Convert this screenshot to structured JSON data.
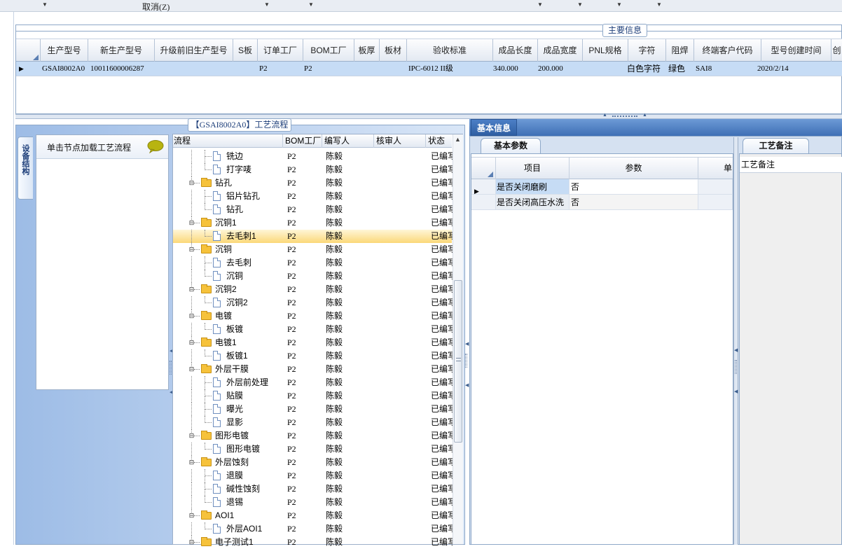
{
  "toolbar": {
    "cancel_label": "取消(Z)"
  },
  "main_info": {
    "title": "主要信息",
    "columns": [
      "生产型号",
      "新生产型号",
      "升级前旧生产型号",
      "S板",
      "订单工厂",
      "BOM工厂",
      "板厚",
      "板材",
      "验收标准",
      "成品长度",
      "成品宽度",
      "PNL规格",
      "字符",
      "阻焊",
      "终端客户代码",
      "型号创建时间",
      "创"
    ],
    "row": {
      "production_model": "GSAI8002A0",
      "new_model": "10011600006287",
      "old_model": "",
      "s_board": "",
      "order_factory": "P2",
      "bom_factory": "P2",
      "thickness": "",
      "material": "",
      "acceptance": "IPC-6012 II级",
      "length": "340.000",
      "width": "200.000",
      "pnl": "",
      "char": "白色字符",
      "solder_mask": "绿色",
      "customer_code": "SAI8",
      "created": "2020/2/14"
    }
  },
  "process": {
    "title": "【GSAI8002A0】工艺流程",
    "side_tab_label": "设备结构",
    "tree_hint": "单击节点加载工艺流程",
    "columns": [
      "流程",
      "BOM工厂",
      "编写人",
      "核审人",
      "状态"
    ],
    "rows": [
      {
        "level": 2,
        "name": "铣边",
        "factory": "P2",
        "writer": "陈毅",
        "reviewer": "",
        "status": "已编写",
        "folder": false
      },
      {
        "level": 2,
        "name": "打字唛",
        "factory": "P2",
        "writer": "陈毅",
        "reviewer": "",
        "status": "已编写",
        "folder": false
      },
      {
        "level": 1,
        "name": "钻孔",
        "factory": "P2",
        "writer": "陈毅",
        "reviewer": "",
        "status": "已编写",
        "folder": true
      },
      {
        "level": 2,
        "name": "铝片钻孔",
        "factory": "P2",
        "writer": "陈毅",
        "reviewer": "",
        "status": "已编写",
        "folder": false
      },
      {
        "level": 2,
        "name": "钻孔",
        "factory": "P2",
        "writer": "陈毅",
        "reviewer": "",
        "status": "已编写",
        "folder": false
      },
      {
        "level": 1,
        "name": "沉铜1",
        "factory": "P2",
        "writer": "陈毅",
        "reviewer": "",
        "status": "已编写",
        "folder": true
      },
      {
        "level": 2,
        "name": "去毛刺1",
        "factory": "P2",
        "writer": "陈毅",
        "reviewer": "",
        "status": "已编写",
        "folder": false,
        "selected": true
      },
      {
        "level": 1,
        "name": "沉铜",
        "factory": "P2",
        "writer": "陈毅",
        "reviewer": "",
        "status": "已编写",
        "folder": true
      },
      {
        "level": 2,
        "name": "去毛刺",
        "factory": "P2",
        "writer": "陈毅",
        "reviewer": "",
        "status": "已编写",
        "folder": false
      },
      {
        "level": 2,
        "name": "沉铜",
        "factory": "P2",
        "writer": "陈毅",
        "reviewer": "",
        "status": "已编写",
        "folder": false
      },
      {
        "level": 1,
        "name": "沉铜2",
        "factory": "P2",
        "writer": "陈毅",
        "reviewer": "",
        "status": "已编写",
        "folder": true
      },
      {
        "level": 2,
        "name": "沉铜2",
        "factory": "P2",
        "writer": "陈毅",
        "reviewer": "",
        "status": "已编写",
        "folder": false
      },
      {
        "level": 1,
        "name": "电镀",
        "factory": "P2",
        "writer": "陈毅",
        "reviewer": "",
        "status": "已编写",
        "folder": true
      },
      {
        "level": 2,
        "name": "板镀",
        "factory": "P2",
        "writer": "陈毅",
        "reviewer": "",
        "status": "已编写",
        "folder": false
      },
      {
        "level": 1,
        "name": "电镀1",
        "factory": "P2",
        "writer": "陈毅",
        "reviewer": "",
        "status": "已编写",
        "folder": true
      },
      {
        "level": 2,
        "name": "板镀1",
        "factory": "P2",
        "writer": "陈毅",
        "reviewer": "",
        "status": "已编写",
        "folder": false
      },
      {
        "level": 1,
        "name": "外层干膜",
        "factory": "P2",
        "writer": "陈毅",
        "reviewer": "",
        "status": "已编写",
        "folder": true
      },
      {
        "level": 2,
        "name": "外层前处理",
        "factory": "P2",
        "writer": "陈毅",
        "reviewer": "",
        "status": "已编写",
        "folder": false
      },
      {
        "level": 2,
        "name": "贴膜",
        "factory": "P2",
        "writer": "陈毅",
        "reviewer": "",
        "status": "已编写",
        "folder": false
      },
      {
        "level": 2,
        "name": "曝光",
        "factory": "P2",
        "writer": "陈毅",
        "reviewer": "",
        "status": "已编写",
        "folder": false
      },
      {
        "level": 2,
        "name": "显影",
        "factory": "P2",
        "writer": "陈毅",
        "reviewer": "",
        "status": "已编写",
        "folder": false
      },
      {
        "level": 1,
        "name": "图形电镀",
        "factory": "P2",
        "writer": "陈毅",
        "reviewer": "",
        "status": "已编写",
        "folder": true
      },
      {
        "level": 2,
        "name": "图形电镀",
        "factory": "P2",
        "writer": "陈毅",
        "reviewer": "",
        "status": "已编写",
        "folder": false
      },
      {
        "level": 1,
        "name": "外层蚀刻",
        "factory": "P2",
        "writer": "陈毅",
        "reviewer": "",
        "status": "已编写",
        "folder": true
      },
      {
        "level": 2,
        "name": "退膜",
        "factory": "P2",
        "writer": "陈毅",
        "reviewer": "",
        "status": "已编写",
        "folder": false
      },
      {
        "level": 2,
        "name": "碱性蚀刻",
        "factory": "P2",
        "writer": "陈毅",
        "reviewer": "",
        "status": "已编写",
        "folder": false
      },
      {
        "level": 2,
        "name": "退锡",
        "factory": "P2",
        "writer": "陈毅",
        "reviewer": "",
        "status": "已编写",
        "folder": false
      },
      {
        "level": 1,
        "name": "AOI1",
        "factory": "P2",
        "writer": "陈毅",
        "reviewer": "",
        "status": "已编写",
        "folder": true
      },
      {
        "level": 2,
        "name": "外层AOI1",
        "factory": "P2",
        "writer": "陈毅",
        "reviewer": "",
        "status": "已编写",
        "folder": false
      },
      {
        "level": 1,
        "name": "电子测试1",
        "factory": "P2",
        "writer": "陈毅",
        "reviewer": "",
        "status": "已编写",
        "folder": true
      }
    ]
  },
  "basic_info": {
    "title": "基本信息",
    "param_tab": "基本参数",
    "columns": [
      "项目",
      "参数",
      "单"
    ],
    "rows": [
      {
        "item": "是否关闭磨刷",
        "value": "否"
      },
      {
        "item": "是否关闭高压水洗",
        "value": "否"
      }
    ]
  },
  "remark": {
    "tab": "工艺备注",
    "header": "工艺备注"
  }
}
